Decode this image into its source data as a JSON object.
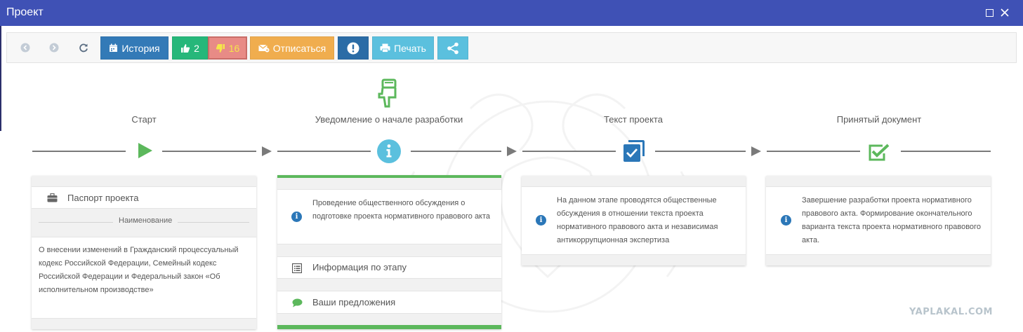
{
  "window": {
    "title": "Проект"
  },
  "toolbar": {
    "history_label": "История",
    "likes_count": "2",
    "dislikes_count": "16",
    "unsubscribe_label": "Отписаться",
    "print_label": "Печать"
  },
  "stages": [
    {
      "label": "Старт"
    },
    {
      "label": "Уведомление о начале разработки"
    },
    {
      "label": "Текст проекта"
    },
    {
      "label": "Принятый документ"
    }
  ],
  "start_card": {
    "passport_label": "Паспорт проекта",
    "name_header": "Наименование",
    "name_value": "О внесении изменений в Гражданский процессуальный кодекс Российской Федерации, Семейный кодекс Российской Федерации и Федеральный закон «Об исполнительном производстве»"
  },
  "notice_card": {
    "description": "Проведение общественного обсуждения о подготовке проекта нормативного правового акта",
    "stage_info_label": "Информация по этапу",
    "proposals_label": "Ваши предложения"
  },
  "text_card": {
    "description": "На данном этапе проводятся общественные обсуждения в отношении текста проекта нормативного правового акта и независимая антикоррупционная экспертиза"
  },
  "accepted_card": {
    "description": "Завершение разработки проекта нормативного правового акта. Формирование окончательного варианта текста проекта нормативного правового акта."
  },
  "watermark_text": "YAPLAKAL.COM",
  "colors": {
    "titlebar": "#3f51b5",
    "history": "#337ab7",
    "like": "#26b77a",
    "dislike": "#e88b86",
    "unsubscribe": "#f0ad4e",
    "alert": "#2b6ca6",
    "print": "#5bc0de",
    "active_stage": "#5cb85c",
    "info": "#5bc0de"
  }
}
